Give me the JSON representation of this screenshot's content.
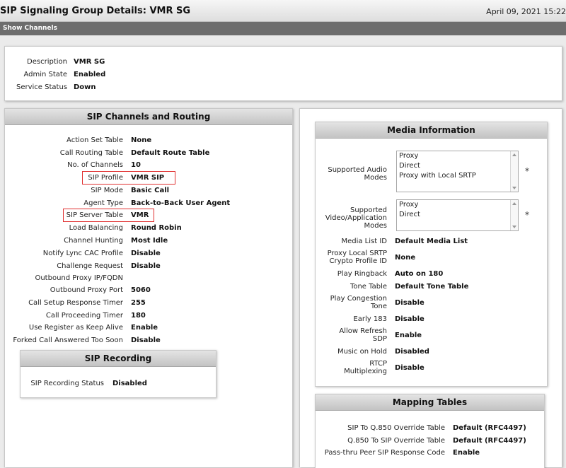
{
  "header": {
    "title": "SIP Signaling Group Details: VMR SG",
    "datetime": "April 09, 2021 15:22"
  },
  "toolbar": {
    "show_channels": "Show Channels"
  },
  "summary": {
    "rows": [
      {
        "label": "Description",
        "value": "VMR SG"
      },
      {
        "label": "Admin State",
        "value": "Enabled"
      },
      {
        "label": "Service Status",
        "value": "Down"
      }
    ]
  },
  "channels": {
    "title": "SIP Channels and Routing",
    "rows": [
      {
        "label": "Action Set Table",
        "value": "None"
      },
      {
        "label": "Call Routing Table",
        "value": "Default Route Table"
      },
      {
        "label": "No. of Channels",
        "value": "10"
      },
      {
        "label": "SIP Profile",
        "value": "VMR SIP"
      },
      {
        "label": "SIP Mode",
        "value": "Basic Call"
      },
      {
        "label": "Agent Type",
        "value": "Back-to-Back User Agent"
      },
      {
        "label": "SIP Server Table",
        "value": "VMR"
      },
      {
        "label": "Load Balancing",
        "value": "Round Robin"
      },
      {
        "label": "Channel Hunting",
        "value": "Most Idle"
      },
      {
        "label": "Notify Lync CAC Profile",
        "value": "Disable"
      },
      {
        "label": "Challenge Request",
        "value": "Disable"
      },
      {
        "label": "Outbound Proxy IP/FQDN",
        "value": ""
      },
      {
        "label": "Outbound Proxy Port",
        "value": "5060"
      },
      {
        "label": "Call Setup Response Timer",
        "value": "255"
      },
      {
        "label": "Call Proceeding Timer",
        "value": "180"
      },
      {
        "label": "Use Register as Keep Alive",
        "value": "Enable"
      },
      {
        "label": "Forked Call Answered Too Soon",
        "value": "Disable"
      }
    ]
  },
  "recording": {
    "title": "SIP Recording",
    "status_label": "SIP Recording Status",
    "status_value": "Disabled"
  },
  "media": {
    "title": "Media Information",
    "audio_label_1": "Supported Audio",
    "audio_label_2": "Modes",
    "audio_options": [
      "Proxy",
      "Direct",
      "Proxy with Local SRTP"
    ],
    "video_label_1": "Supported",
    "video_label_2": "Video/Application",
    "video_label_3": "Modes",
    "video_options": [
      "Proxy",
      "Direct"
    ],
    "asterisk": "*",
    "rows": [
      {
        "l1": "Media List ID",
        "l2": "",
        "value": "Default Media List"
      },
      {
        "l1": "Proxy Local SRTP",
        "l2": "Crypto Profile ID",
        "value": "None"
      },
      {
        "l1": "Play Ringback",
        "l2": "",
        "value": "Auto on 180"
      },
      {
        "l1": "Tone Table",
        "l2": "",
        "value": "Default Tone Table"
      },
      {
        "l1": "Play Congestion",
        "l2": "Tone",
        "value": "Disable"
      },
      {
        "l1": "Early 183",
        "l2": "",
        "value": "Disable"
      },
      {
        "l1": "Allow Refresh",
        "l2": "SDP",
        "value": "Enable"
      },
      {
        "l1": "Music on Hold",
        "l2": "",
        "value": "Disabled"
      },
      {
        "l1": "RTCP",
        "l2": "Multiplexing",
        "value": "Disable"
      }
    ]
  },
  "mapping": {
    "title": "Mapping Tables",
    "rows": [
      {
        "label": "SIP To Q.850 Override Table",
        "value": "Default (RFC4497)"
      },
      {
        "label": "Q.850 To SIP Override Table",
        "value": "Default (RFC4497)"
      },
      {
        "label": "Pass-thru Peer SIP Response Code",
        "value": "Enable"
      }
    ]
  },
  "colors": {
    "highlight": "#e03030",
    "toolbar": "#6d6d6d"
  }
}
